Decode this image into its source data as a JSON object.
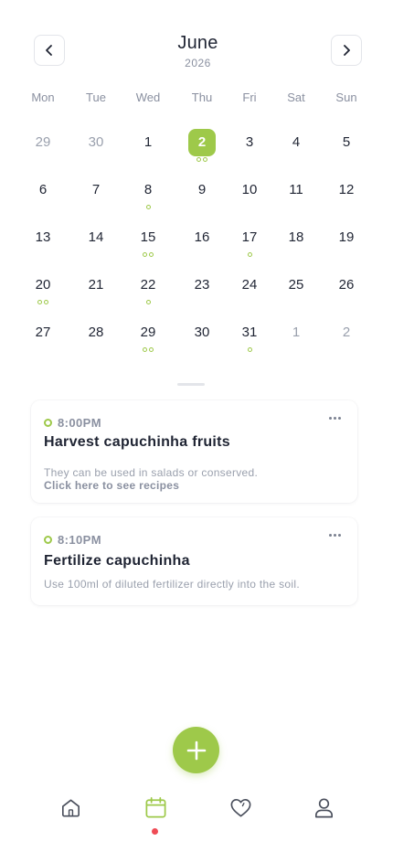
{
  "header": {
    "month": "June",
    "year": "2026"
  },
  "weekdays": [
    "Mon",
    "Tue",
    "Wed",
    "Thu",
    "Fri",
    "Sat",
    "Sun"
  ],
  "calendar": {
    "weeks": [
      [
        {
          "day": "29",
          "muted": true,
          "dots": 0
        },
        {
          "day": "30",
          "muted": true,
          "dots": 0
        },
        {
          "day": "1",
          "muted": false,
          "dots": 0
        },
        {
          "day": "2",
          "muted": false,
          "dots": 2,
          "today": true
        },
        {
          "day": "3",
          "muted": false,
          "dots": 0
        },
        {
          "day": "4",
          "muted": false,
          "dots": 0
        },
        {
          "day": "5",
          "muted": false,
          "dots": 0
        }
      ],
      [
        {
          "day": "6",
          "muted": false,
          "dots": 0
        },
        {
          "day": "7",
          "muted": false,
          "dots": 0
        },
        {
          "day": "8",
          "muted": false,
          "dots": 1
        },
        {
          "day": "9",
          "muted": false,
          "dots": 0
        },
        {
          "day": "10",
          "muted": false,
          "dots": 0
        },
        {
          "day": "11",
          "muted": false,
          "dots": 0
        },
        {
          "day": "12",
          "muted": false,
          "dots": 0
        }
      ],
      [
        {
          "day": "13",
          "muted": false,
          "dots": 0
        },
        {
          "day": "14",
          "muted": false,
          "dots": 0
        },
        {
          "day": "15",
          "muted": false,
          "dots": 2
        },
        {
          "day": "16",
          "muted": false,
          "dots": 0
        },
        {
          "day": "17",
          "muted": false,
          "dots": 1
        },
        {
          "day": "18",
          "muted": false,
          "dots": 0
        },
        {
          "day": "19",
          "muted": false,
          "dots": 0
        }
      ],
      [
        {
          "day": "20",
          "muted": false,
          "dots": 2
        },
        {
          "day": "21",
          "muted": false,
          "dots": 0
        },
        {
          "day": "22",
          "muted": false,
          "dots": 1
        },
        {
          "day": "23",
          "muted": false,
          "dots": 0
        },
        {
          "day": "24",
          "muted": false,
          "dots": 0
        },
        {
          "day": "25",
          "muted": false,
          "dots": 0
        },
        {
          "day": "26",
          "muted": false,
          "dots": 0
        }
      ],
      [
        {
          "day": "27",
          "muted": false,
          "dots": 0
        },
        {
          "day": "28",
          "muted": false,
          "dots": 0
        },
        {
          "day": "29",
          "muted": false,
          "dots": 2
        },
        {
          "day": "30",
          "muted": false,
          "dots": 0
        },
        {
          "day": "31",
          "muted": false,
          "dots": 1
        },
        {
          "day": "1",
          "muted": true,
          "dots": 0
        },
        {
          "day": "2",
          "muted": true,
          "dots": 0
        }
      ]
    ]
  },
  "events": [
    {
      "time": "8:00PM",
      "title": "Harvest capuchinha fruits",
      "description": "They can be used in salads or conserved.",
      "link": "Click here to see recipes"
    },
    {
      "time": "8:10PM",
      "title": "Fertilize capuchinha",
      "description": "Use 100ml of diluted fertilizer directly into the soil."
    }
  ],
  "bottom_nav": {
    "tabs": [
      {
        "icon": "home-icon"
      },
      {
        "icon": "calendar-icon",
        "active": true
      },
      {
        "icon": "heart-icon"
      },
      {
        "icon": "profile-icon"
      }
    ]
  },
  "colors": {
    "accent": "#9ec94a",
    "text": "#1f2433",
    "muted": "#8a90a0",
    "notification": "#ef4b55"
  }
}
